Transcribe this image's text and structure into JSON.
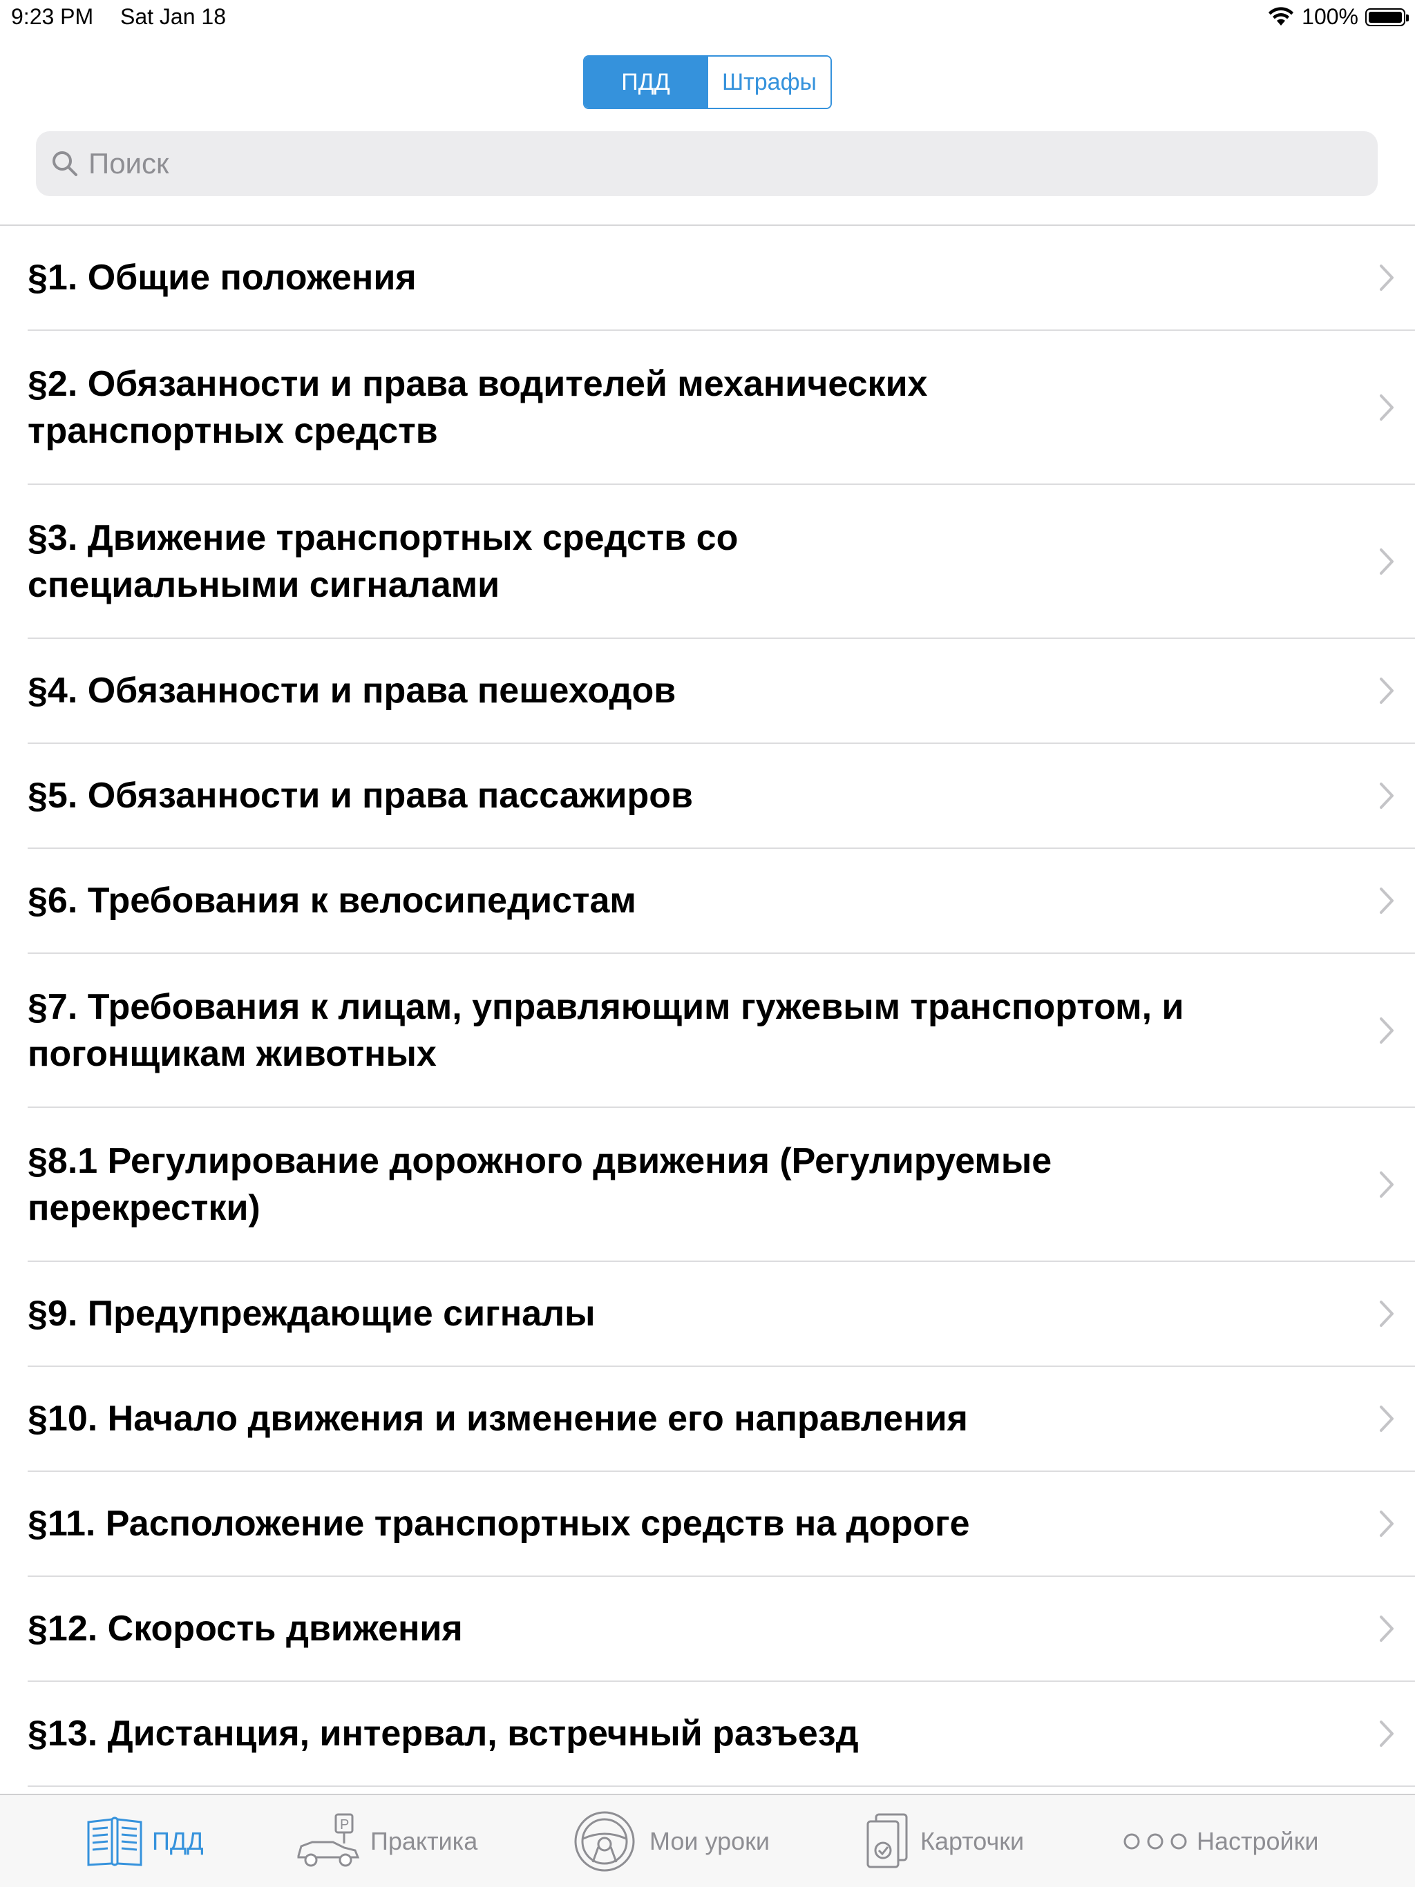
{
  "status_bar": {
    "time": "9:23 PM",
    "date": "Sat Jan 18",
    "battery": "100%"
  },
  "segmented": {
    "items": [
      {
        "label": "ПДД",
        "selected": true
      },
      {
        "label": "Штрафы",
        "selected": false
      }
    ]
  },
  "search": {
    "placeholder": "Поиск",
    "value": ""
  },
  "sections": [
    "§1. Общие положения",
    "§2. Обязанности и права водителей механических транспортных средств",
    "§3. Движение транспортных средств со специальными сигналами",
    "§4. Обязанности и права пешеходов",
    "§5. Обязанности и права пассажиров",
    "§6. Требования к велосипедистам",
    "§7. Требования к лицам, управляющим гужевым транспортом, и погонщикам животных",
    "§8.1 Регулирование дорожного движения (Регулируемые перекрестки)",
    "§9. Предупреждающие сигналы",
    "§10. Начало движения и изменение его направления",
    "§11. Расположение транспортных средств на дороге",
    "§12. Скорость движения",
    "§13. Дистанция, интервал, встречный разъезд"
  ],
  "tabs": [
    {
      "label": "ПДД",
      "icon": "book-icon",
      "active": true
    },
    {
      "label": "Практика",
      "icon": "car-parking-icon",
      "active": false
    },
    {
      "label": "Мои уроки",
      "icon": "steering-wheel-icon",
      "active": false
    },
    {
      "label": "Карточки",
      "icon": "cards-icon",
      "active": false
    },
    {
      "label": "Настройки",
      "icon": "more-icon",
      "active": false
    }
  ],
  "colors": {
    "accent": "#3592dc",
    "inactive": "#8e8e93"
  }
}
